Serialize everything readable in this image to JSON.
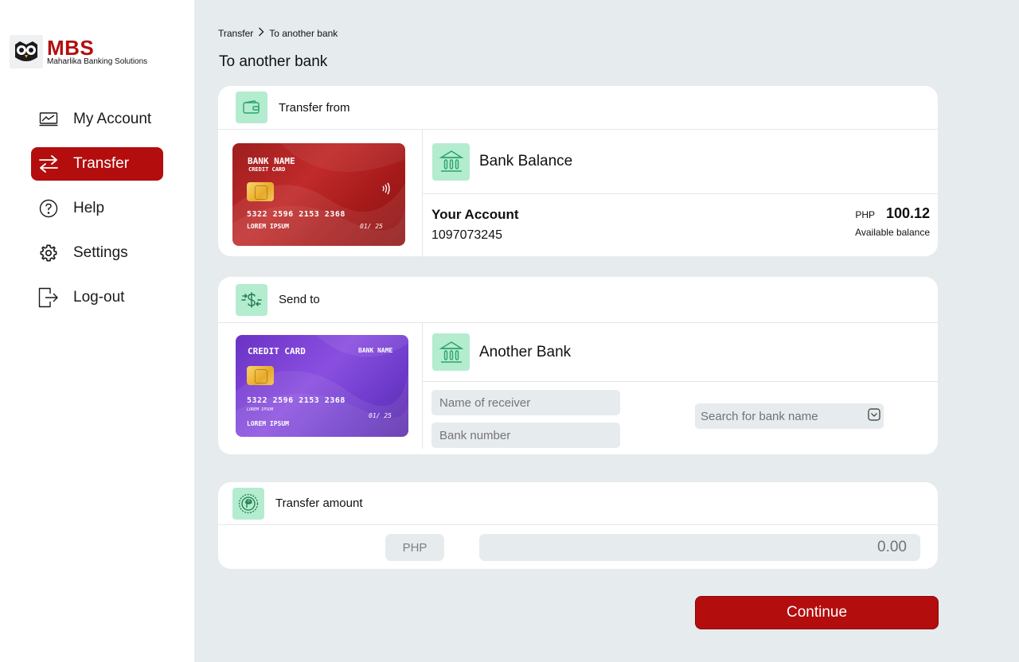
{
  "brand": {
    "title": "MBS",
    "subtitle": "Maharlika Banking Solutions"
  },
  "nav": [
    {
      "label": "My Account",
      "icon": "chart-icon"
    },
    {
      "label": "Transfer",
      "icon": "transfer-arrows-icon",
      "active": true
    },
    {
      "label": "Help",
      "icon": "help-icon"
    },
    {
      "label": "Settings",
      "icon": "gear-icon"
    },
    {
      "label": "Log-out",
      "icon": "logout-icon"
    }
  ],
  "breadcrumb": {
    "parent": "Transfer",
    "current": "To another bank"
  },
  "page_title": "To another bank",
  "transfer_from": {
    "header": "Transfer from",
    "card": {
      "bank_name": "BANK NAME",
      "type": "CREDIT CARD",
      "number": "5322 2596 2153 2368",
      "holder": "LOREM IPSUM",
      "expiry": "01/ 25"
    },
    "bank_title": "Bank Balance",
    "account_label": "Your Account",
    "account_number": "1097073245",
    "currency": "PHP",
    "balance": "100.12",
    "balance_caption": "Available balance"
  },
  "send_to": {
    "header": "Send to",
    "card": {
      "type": "CREDIT CARD",
      "bank_name": "BANK NAME",
      "number": "5322 2596 2153 2368",
      "small_holder": "LOREM IPSUM",
      "holder": "LOREM IPSUM",
      "expiry": "01/ 25"
    },
    "bank_title": "Another Bank",
    "receiver_placeholder": "Name of receiver",
    "bank_number_placeholder": "Bank number",
    "bank_search_placeholder": "Search for bank name"
  },
  "amount": {
    "header": "Transfer amount",
    "currency": "PHP",
    "value": "0.00"
  },
  "continue_label": "Continue",
  "colors": {
    "brand_red": "#b30d0d",
    "accent_green": "#b4ecd0",
    "icon_green": "#2aa46a",
    "background": "#e6ebee"
  }
}
